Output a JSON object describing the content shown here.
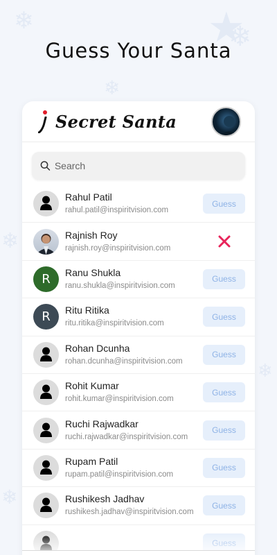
{
  "headline": "Guess Your Santa",
  "brand": {
    "title": "Secret Santa"
  },
  "search": {
    "placeholder": "Search"
  },
  "guess_label": "Guess",
  "contacts": [
    {
      "name": "Rahul Patil",
      "email": "rahul.patil@inspiritvision.com",
      "avatar": "generic",
      "action": "guess"
    },
    {
      "name": "Rajnish Roy",
      "email": "rajnish.roy@inspiritvision.com",
      "avatar": "photo",
      "action": "rejected"
    },
    {
      "name": "Ranu Shukla",
      "email": "ranu.shukla@inspiritvision.com",
      "avatar": "letter",
      "initial": "R",
      "color": "#2e6b2a",
      "action": "guess"
    },
    {
      "name": "Ritu Ritika",
      "email": "ritu.ritika@inspiritvision.com",
      "avatar": "letter",
      "initial": "R",
      "color": "#3d4a55",
      "action": "guess"
    },
    {
      "name": "Rohan Dcunha",
      "email": "rohan.dcunha@inspiritvision.com",
      "avatar": "generic",
      "action": "guess"
    },
    {
      "name": "Rohit Kumar",
      "email": "rohit.kumar@inspiritvision.com",
      "avatar": "generic",
      "action": "guess"
    },
    {
      "name": "Ruchi Rajwadkar",
      "email": "ruchi.rajwadkar@inspiritvision.com",
      "avatar": "generic",
      "action": "guess"
    },
    {
      "name": "Rupam Patil",
      "email": "rupam.patil@inspiritvision.com",
      "avatar": "generic",
      "action": "guess"
    },
    {
      "name": "Rushikesh Jadhav",
      "email": "rushikesh.jadhav@inspiritvision.com",
      "avatar": "generic",
      "action": "guess"
    },
    {
      "name": "",
      "email": "",
      "avatar": "generic",
      "action": "guess"
    }
  ],
  "colors": {
    "accent_red": "#e11d2a",
    "reject_pink": "#e8245a",
    "guess_bg": "#e6effb",
    "guess_text": "#8fb3e6"
  }
}
